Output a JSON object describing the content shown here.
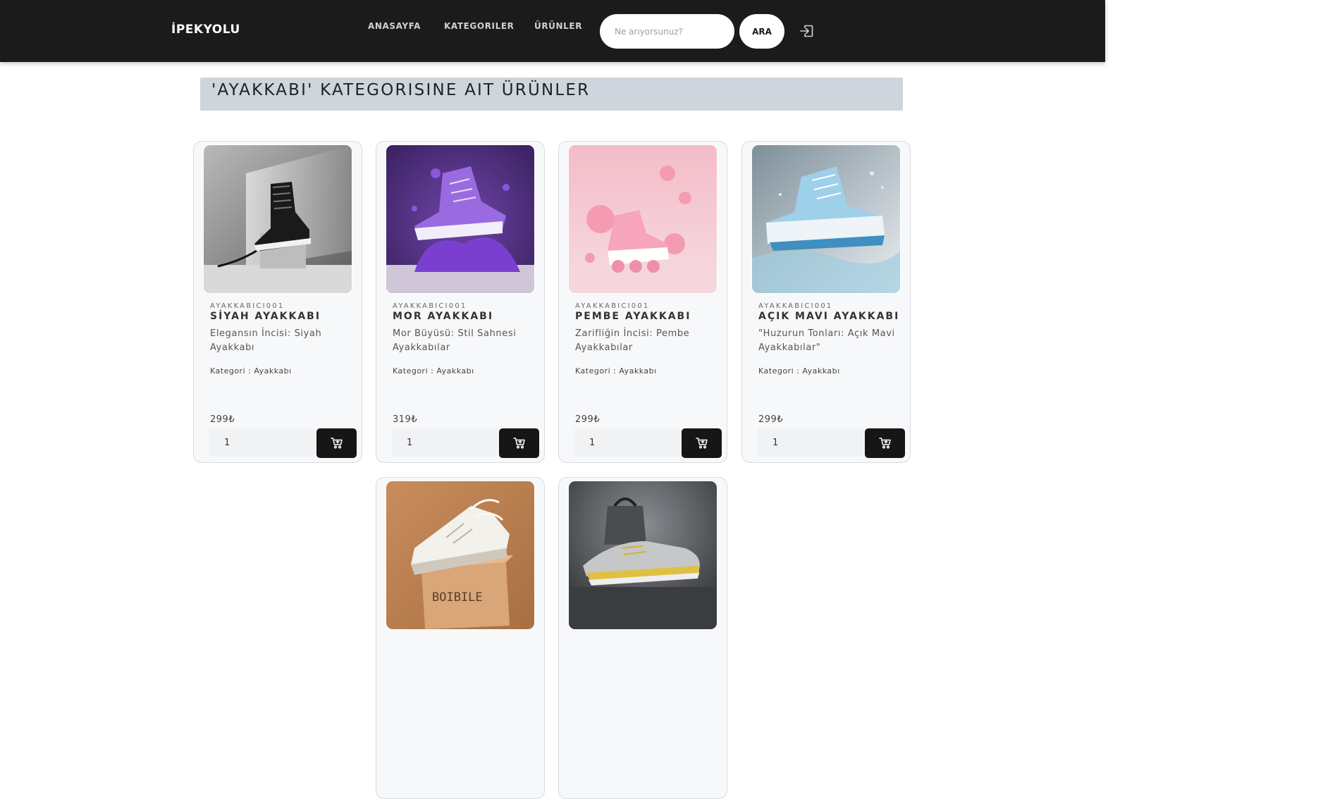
{
  "navbar": {
    "brand": "İPEKYOLU",
    "links": [
      "ANASAYFA",
      "KATEGORILER",
      "ÜRÜNLER"
    ],
    "search_placeholder": "Ne arıyorsunuz?",
    "search_value": "",
    "search_button": "ARA",
    "login_icon": "login-icon"
  },
  "heading": "'AYAKKABI' KATEGORISINE AIT ÜRÜNLER",
  "colors": {
    "navbar": "#1b1b1b",
    "heading_bg": "#cfd5dd",
    "cart_button": "#161616",
    "card_bg": "#f7f8fa"
  },
  "products": [
    {
      "seller": "AYAKKABICI001",
      "name": "SİYAH AYAKKABI",
      "description": "Elegansın İncisi: Siyah Ayakkabı",
      "category": "Kategori : Ayakkabı",
      "price": "299₺",
      "quantity": "1",
      "image": "black-sneaker-on-marble"
    },
    {
      "seller": "AYAKKABICI001",
      "name": "MOR AYAKKABI",
      "description": "Mor Büyüsü: Stil Sahnesi Ayakkabılar",
      "category": "Kategori : Ayakkabı",
      "price": "319₺",
      "quantity": "1",
      "image": "purple-sneaker-splash"
    },
    {
      "seller": "AYAKKABICI001",
      "name": "PEMBE AYAKKABI",
      "description": "Zarifliğin İncisi: Pembe Ayakkabılar",
      "category": "Kategori : Ayakkabı",
      "price": "299₺",
      "quantity": "1",
      "image": "pink-sneaker-bubbles"
    },
    {
      "seller": "AYAKKABICI001",
      "name": "AÇIK MAVI AYAKKABI",
      "description": "\"Huzurun Tonları: Açık Mavi Ayakkabılar\"",
      "category": "Kategori : Ayakkabı",
      "price": "299₺",
      "quantity": "1",
      "image": "light-blue-sneaker-water"
    },
    {
      "image": "white-sneaker-on-box",
      "box_text": "BOIBILE"
    },
    {
      "image": "grey-yellow-shoe-with-bag"
    }
  ]
}
